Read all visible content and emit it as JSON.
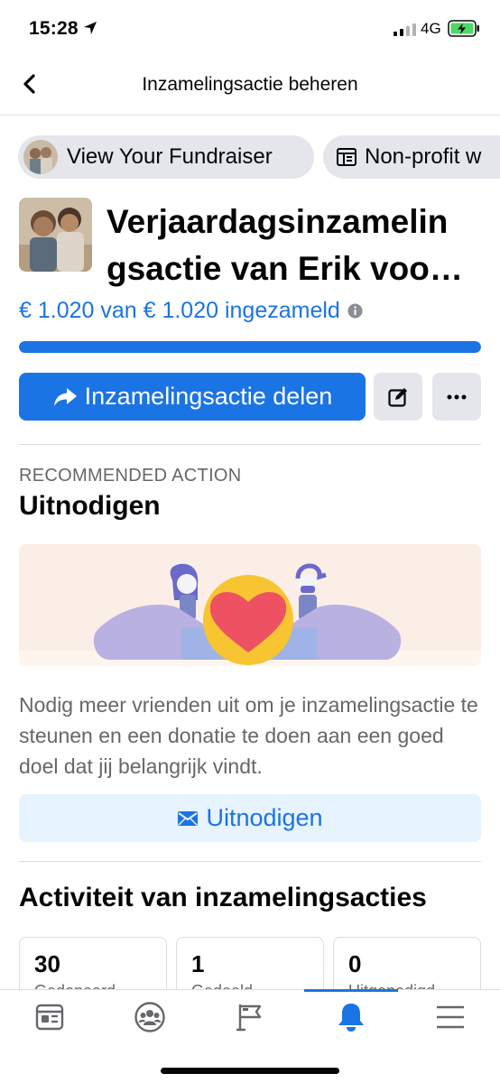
{
  "status_bar": {
    "time": "15:28",
    "network": "4G"
  },
  "nav": {
    "title": "Inzamelingsactie beheren"
  },
  "chips": [
    {
      "label": "View Your Fundraiser"
    },
    {
      "label": "Non-profit w"
    }
  ],
  "fundraiser": {
    "title": "Verjaardagsinzamelin gsactie van Erik voo…",
    "raised_text": "€ 1.020 van € 1.020 ingezameld",
    "progress_fraction": 1.0,
    "share_label": "Inzamelingsactie delen"
  },
  "recommended": {
    "label": "RECOMMENDED ACTION",
    "title": "Uitnodigen",
    "description": "Nodig meer vrienden uit om je inzamelingsactie te steunen en een donatie te doen aan een goed doel dat jij belangrijk vindt.",
    "button_label": "Uitnodigen"
  },
  "activity": {
    "title": "Activiteit van inzamelingsacties",
    "stats": [
      {
        "value": "30",
        "label": "Gedoneerd"
      },
      {
        "value": "1",
        "label": "Gedeeld"
      },
      {
        "value": "0",
        "label": "Uitgenodigd"
      }
    ]
  },
  "tabs": [
    {
      "icon": "news-feed-icon"
    },
    {
      "icon": "groups-icon"
    },
    {
      "icon": "pages-flag-icon"
    },
    {
      "icon": "notifications-bell-icon",
      "active": true
    },
    {
      "icon": "menu-icon"
    }
  ],
  "colors": {
    "accent": "#1b74e4",
    "light_accent": "#e7f3ff",
    "chip_bg": "#e4e6eb"
  }
}
